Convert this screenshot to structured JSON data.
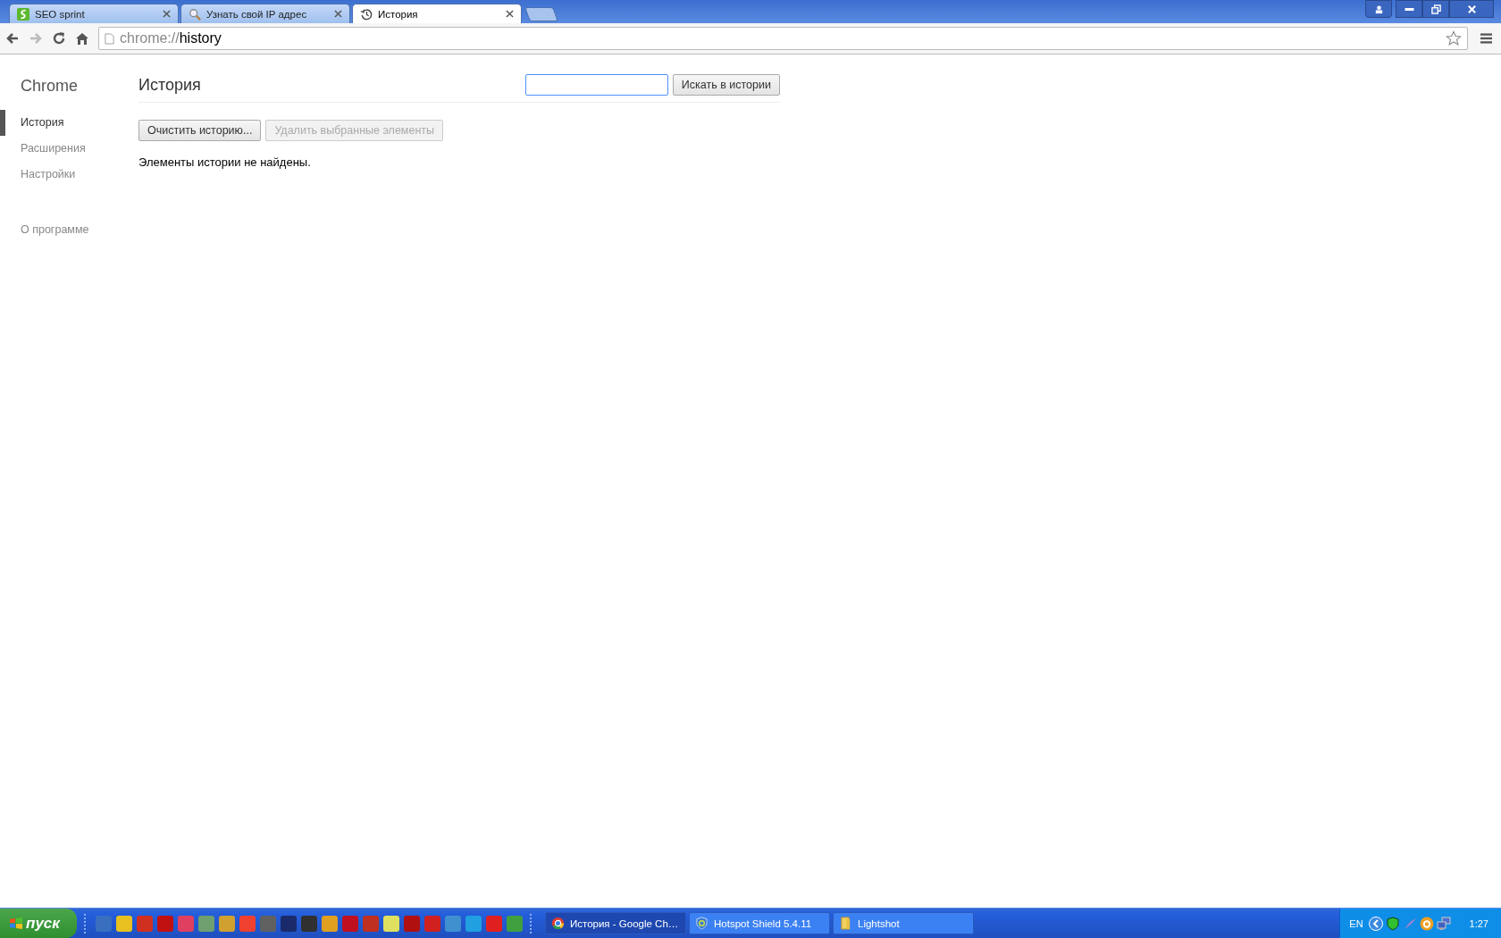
{
  "browser": {
    "tabs": [
      {
        "title": "SEO sprint",
        "kind": "site",
        "selected": false
      },
      {
        "title": "Узнать свой IP адрес",
        "kind": "search",
        "selected": false
      },
      {
        "title": "История",
        "kind": "history",
        "selected": true
      }
    ],
    "address": {
      "scheme": "chrome://",
      "path": "history"
    }
  },
  "sidebar": {
    "title": "Chrome",
    "items": [
      {
        "label": "История",
        "selected": true
      },
      {
        "label": "Расширения",
        "selected": false
      },
      {
        "label": "Настройки",
        "selected": false
      }
    ],
    "about": "О программе"
  },
  "page": {
    "title": "История",
    "search_button": "Искать в истории",
    "buttons": [
      {
        "label": "Очистить историю...",
        "disabled": false
      },
      {
        "label": "Удалить выбранные элементы",
        "disabled": true
      }
    ],
    "message": "Элементы истории не найдены."
  },
  "taskbar": {
    "start": "пуск",
    "windows": [
      {
        "title": "История - Google Ch…",
        "kind": "browser",
        "selected": true
      },
      {
        "title": "Hotspot Shield 5.4.11",
        "kind": "shield",
        "selected": false
      },
      {
        "title": "Lightshot",
        "kind": "folder",
        "selected": false
      }
    ],
    "language": "EN",
    "clock": "1:27"
  }
}
